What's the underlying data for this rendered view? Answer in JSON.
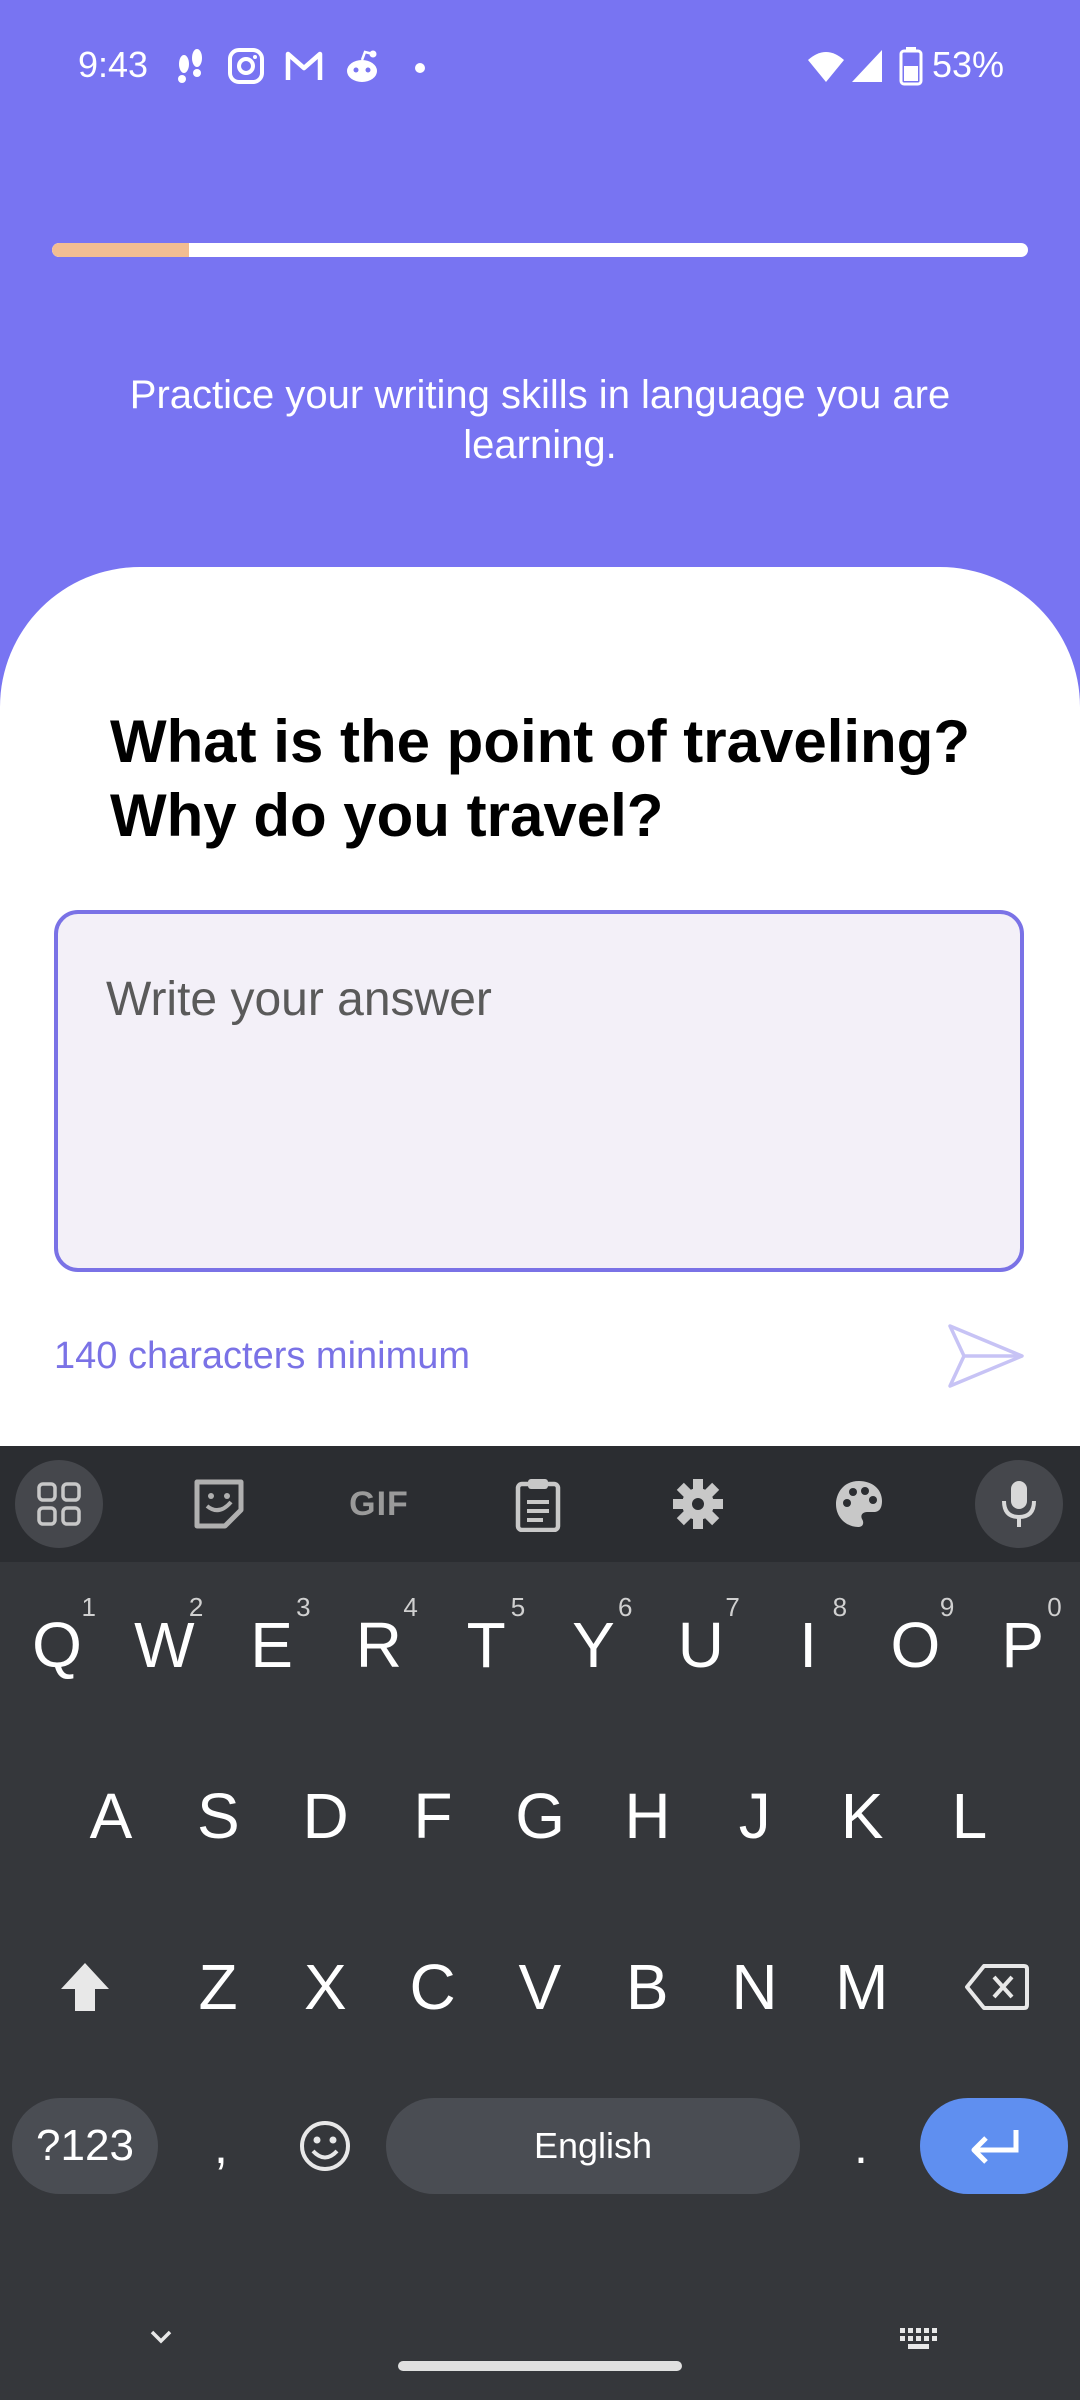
{
  "status_bar": {
    "time": "9:43",
    "battery": "53%",
    "notification_icons": [
      "footsteps-icon",
      "instagram-icon",
      "gmail-icon",
      "reddit-icon",
      "dot-icon"
    ],
    "system_icons": [
      "wifi-icon",
      "signal-icon",
      "battery-icon"
    ]
  },
  "progress": {
    "value": 0.14
  },
  "header": {
    "subtitle": "Practice your writing skills in language you are learning."
  },
  "question": {
    "title": "What is the point of traveling? Why do you travel?"
  },
  "answer": {
    "placeholder": "Write your answer",
    "value": ""
  },
  "helper": {
    "min_chars": "140 characters minimum"
  },
  "colors": {
    "background": "#7874f2",
    "accent": "#7a72e6",
    "progress_fill": "#f2bd92",
    "keyboard": "#35373b",
    "enter_key": "#5f8ff0"
  },
  "keyboard": {
    "toolbar_icons": [
      "apps-grid-icon",
      "sticker-icon",
      "gif-icon",
      "clipboard-icon",
      "settings-gear-icon",
      "palette-icon",
      "microphone-icon"
    ],
    "gif_label": "GIF",
    "row1": [
      {
        "label": "Q",
        "hint": "1"
      },
      {
        "label": "W",
        "hint": "2"
      },
      {
        "label": "E",
        "hint": "3"
      },
      {
        "label": "R",
        "hint": "4"
      },
      {
        "label": "T",
        "hint": "5"
      },
      {
        "label": "Y",
        "hint": "6"
      },
      {
        "label": "U",
        "hint": "7"
      },
      {
        "label": "I",
        "hint": "8"
      },
      {
        "label": "O",
        "hint": "9"
      },
      {
        "label": "P",
        "hint": "0"
      }
    ],
    "row2": [
      "A",
      "S",
      "D",
      "F",
      "G",
      "H",
      "J",
      "K",
      "L"
    ],
    "row3": [
      "Z",
      "X",
      "C",
      "V",
      "B",
      "N",
      "M"
    ],
    "symbols_key": "?123",
    "comma_key": ",",
    "space_key": "English",
    "period_key": "."
  }
}
